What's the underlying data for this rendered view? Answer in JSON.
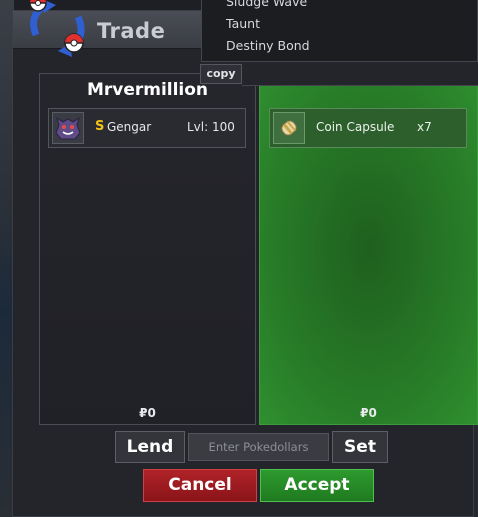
{
  "window": {
    "title": "Trade"
  },
  "movelist": {
    "moves": [
      "Sludge Wave",
      "Taunt",
      "Destiny Bond"
    ],
    "copy_label": "copy"
  },
  "left_panel": {
    "owner": "Mrvermillion",
    "slot": {
      "icon": "gengar-icon",
      "shiny_mark": "S",
      "name": "Gengar",
      "level": "Lvl: 100"
    },
    "money": "₽0"
  },
  "right_panel": {
    "slot": {
      "icon": "coin-capsule-icon",
      "name": "Coin Capsule",
      "count": "x7"
    },
    "money": "₽0"
  },
  "controls": {
    "lend_label": "Lend",
    "pokedollars_placeholder": "Enter Pokedollars",
    "set_label": "Set",
    "cancel_label": "Cancel",
    "accept_label": "Accept"
  },
  "colors": {
    "accept": "#2e9a2e",
    "cancel": "#b02328",
    "shiny": "#f2c118",
    "offer_panel": "#267826"
  }
}
